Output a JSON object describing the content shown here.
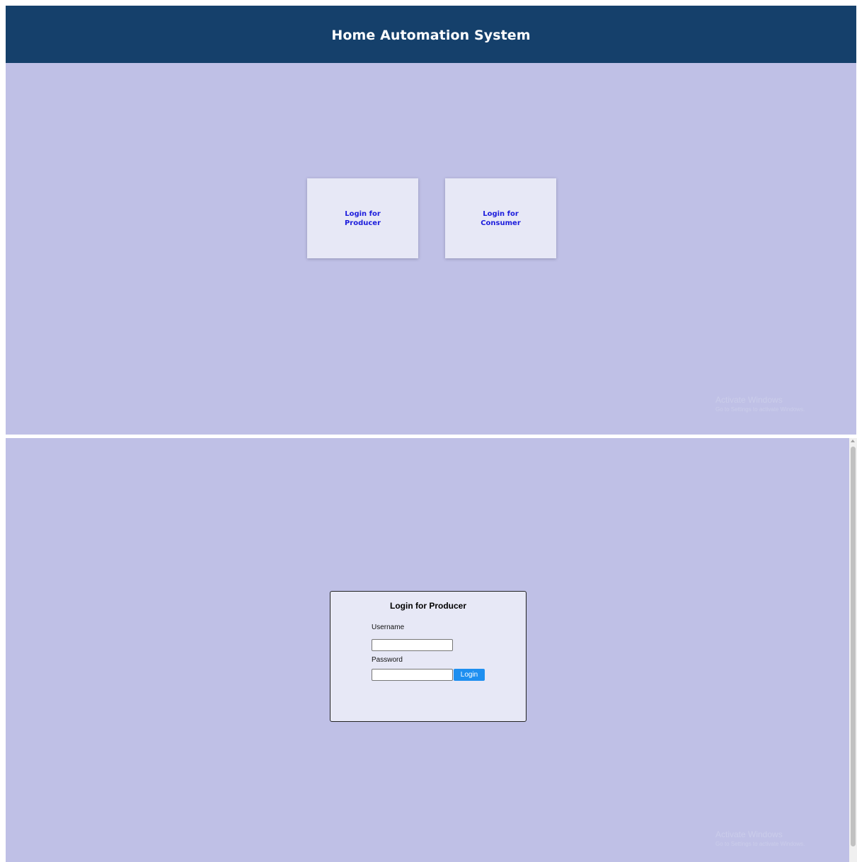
{
  "home": {
    "header": {
      "title": "Home Automation System"
    },
    "cards": [
      {
        "label": "Login for Producer"
      },
      {
        "label": "Login for Consumer"
      }
    ],
    "watermark": {
      "title": "Activate Windows",
      "subtitle": "Go to Settings to activate Windows."
    }
  },
  "producer_login": {
    "form": {
      "title": "Login for Producer",
      "username_label": "Username",
      "username_value": "",
      "password_label": "Password",
      "password_value": "",
      "login_button": "Login"
    },
    "watermark": {
      "title": "Activate Windows",
      "subtitle": "Go to Settings to activate Windows."
    }
  },
  "colors": {
    "header_bg": "#15406b",
    "page_bg": "#bfc0e6",
    "card_bg": "#e7e8f6",
    "card_text": "#1c1cdc",
    "button_bg": "#1e8ff0"
  }
}
